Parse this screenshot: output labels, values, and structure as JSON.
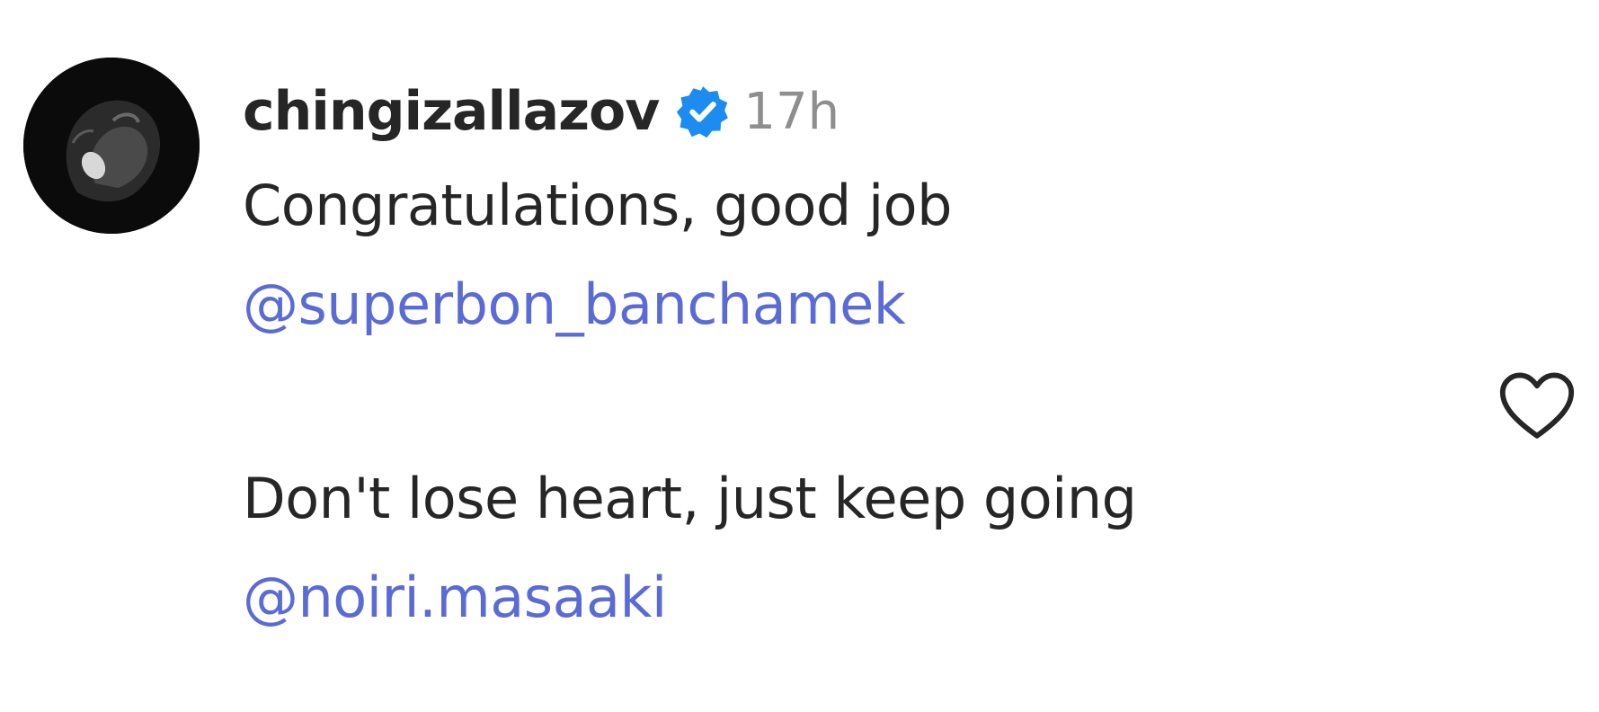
{
  "comment": {
    "username": "chingizallazov",
    "verified_icon": "verified-badge-icon",
    "time": "17h",
    "lines": [
      "Congratulations, good job",
      "@superbon_banchamek",
      "Don't lose heart, just keep going",
      "@noiri.masaaki"
    ],
    "like_icon": "heart-outline-icon"
  },
  "colors": {
    "text": "#262626",
    "muted": "#8e8e8e",
    "mention": "#5a6bd6",
    "verified": "#1d8cf0"
  }
}
